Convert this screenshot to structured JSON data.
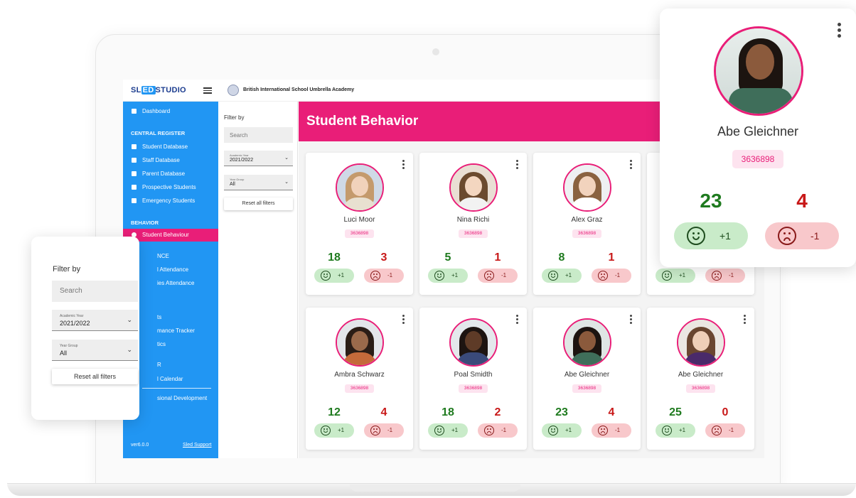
{
  "app": {
    "logo_text_1": "SL",
    "logo_text_2": "ED",
    "logo_text_3": "STUDIO",
    "school_name": "British International School Umbrella Academy"
  },
  "sidebar": {
    "dashboard": "Dashboard",
    "section_central": "CENTRAL REGISTER",
    "central_items": [
      "Student Database",
      "Staff Database",
      "Parent Database",
      "Prospective Students",
      "Emergency Students"
    ],
    "section_behavior": "BEHAVIOR",
    "behavior_active": "Student Behaviour",
    "partial_items": [
      "NCE",
      "l Attendance",
      "ies Attendance",
      "ts",
      "mance Tracker",
      "tics",
      "R",
      "l Calendar",
      "sional Development"
    ],
    "version": "ver6.0.0",
    "support": "Sled Support"
  },
  "filter": {
    "title": "Filter by",
    "search_placeholder": "Search",
    "year_label": "Academic Year",
    "year_value": "2021/2022",
    "group_label": "Year Group",
    "group_value": "All",
    "reset": "Reset all filters"
  },
  "main": {
    "title": "Student Behavior",
    "plus_label": "+1",
    "minus_label": "-1"
  },
  "students": [
    {
      "name": "Luci Moor",
      "id": "3636898",
      "positive": "18",
      "negative": "3"
    },
    {
      "name": "Nina Richi",
      "id": "3636898",
      "positive": "5",
      "negative": "1"
    },
    {
      "name": "Alex Graz",
      "id": "3636898",
      "positive": "8",
      "negative": "1"
    },
    {
      "name": "Ambra Schwarz",
      "id": "3636898",
      "positive": "12",
      "negative": "4"
    },
    {
      "name": "Poal Smidth",
      "id": "3636898",
      "positive": "18",
      "negative": "2"
    },
    {
      "name": "Abe Gleichner",
      "id": "3636898",
      "positive": "23",
      "negative": "4"
    },
    {
      "name": "Abe Gleichner",
      "id": "3636898",
      "positive": "25",
      "negative": "0"
    }
  ],
  "profile": {
    "name": "Abe Gleichner",
    "id": "3636898",
    "positive": "23",
    "negative": "4",
    "plus_label": "+1",
    "minus_label": "-1"
  },
  "colors": {
    "primary_blue": "#2196f3",
    "accent_pink": "#e91e78",
    "positive_green": "#1e7a1e",
    "negative_red": "#c81818"
  }
}
